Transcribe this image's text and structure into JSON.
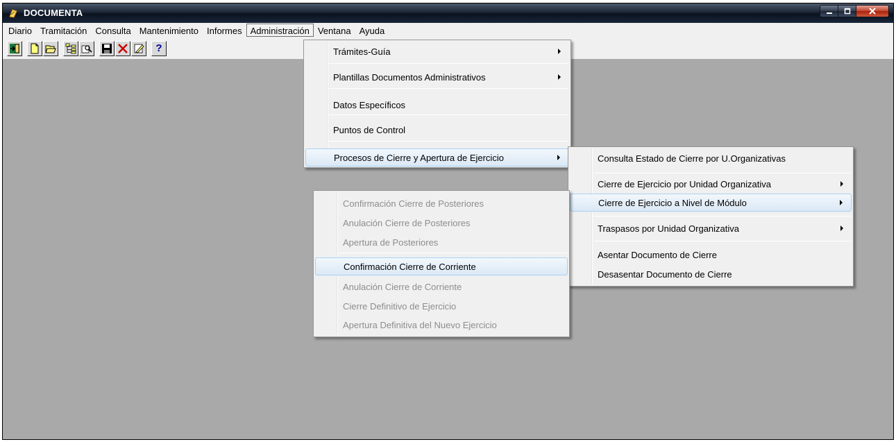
{
  "window": {
    "title": "DOCUMENTA",
    "controls": [
      "minimize",
      "maximize",
      "close"
    ]
  },
  "menubar": {
    "items": [
      "Diario",
      "Tramitación",
      "Consulta",
      "Mantenimiento",
      "Informes",
      "Administración",
      "Ventana",
      "Ayuda"
    ],
    "active": "Administración"
  },
  "toolbar": {
    "buttons": [
      "exit-icon",
      "new-document-icon",
      "open-folder-icon",
      "tree-view-icon",
      "view-icon",
      "save-icon",
      "delete-icon",
      "edit-icon",
      "help-icon"
    ],
    "help_label": "?"
  },
  "admin_menu": {
    "items": [
      {
        "label": "Trámites-Guía",
        "submenu": true
      },
      {
        "label": "Plantillas Documentos Administrativos",
        "submenu": true
      },
      {
        "label": "Datos Específicos",
        "submenu": false
      },
      {
        "label": "Puntos de Control",
        "submenu": false
      },
      {
        "label": "Procesos de Cierre y Apertura de Ejercicio",
        "submenu": true,
        "highlighted": true
      }
    ]
  },
  "cierre_menu": {
    "items": [
      {
        "label": "Consulta Estado de Cierre por U.Organizativas",
        "submenu": false
      },
      {
        "label": "Cierre de Ejercicio por Unidad Organizativa",
        "submenu": true
      },
      {
        "label": "Cierre de Ejercicio a  Nivel de  Módulo",
        "submenu": true,
        "highlighted": true
      },
      {
        "label": "Traspasos por Unidad Organizativa",
        "submenu": true
      },
      {
        "label": "Asentar Documento de Cierre",
        "submenu": false
      },
      {
        "label": "Desasentar Documento de Cierre",
        "submenu": false
      }
    ]
  },
  "modulo_menu": {
    "items": [
      {
        "label": "Confirmación Cierre de Posteriores",
        "enabled": false
      },
      {
        "label": "Anulación Cierre de Posteriores",
        "enabled": false
      },
      {
        "label": "Apertura de Posteriores",
        "enabled": false
      },
      {
        "label": "Confirmación Cierre de Corriente",
        "enabled": true,
        "highlighted": true
      },
      {
        "label": "Anulación Cierre de Corriente",
        "enabled": false
      },
      {
        "label": "Cierre Definitivo de Ejercicio",
        "enabled": false
      },
      {
        "label": "Apertura Definitiva del Nuevo Ejercicio",
        "enabled": false
      }
    ]
  },
  "colors": {
    "workarea": "#a9a9a9",
    "menu_bg": "#f0f0f0",
    "highlight_border": "#a8d1f2",
    "disabled_text": "#8d8d8d"
  }
}
